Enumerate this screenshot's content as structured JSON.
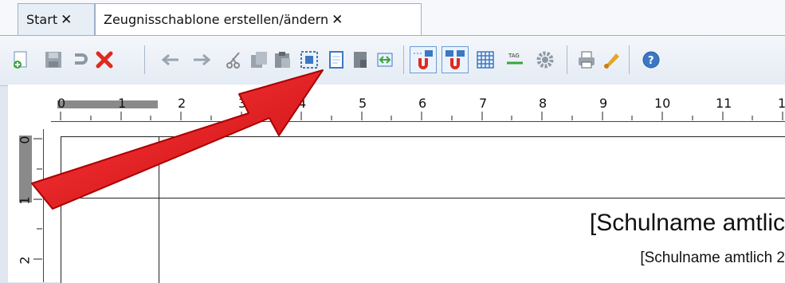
{
  "tabs": [
    {
      "label": "Start",
      "close": "✕",
      "active": false
    },
    {
      "label": "Zeugnisschablone erstellen/ändern",
      "close": "✕",
      "active": true
    }
  ],
  "ruler": {
    "horizontal": [
      "0",
      "1",
      "2",
      "3",
      "4",
      "5",
      "6",
      "7",
      "8",
      "9",
      "10",
      "11",
      "1"
    ],
    "vertical": [
      "0",
      "1",
      "2"
    ]
  },
  "document": {
    "school_name_official": "[Schulname amtlic",
    "school_name_official_2": "[Schulname amtlich 2"
  },
  "toolbar": {
    "icons": [
      "new-document-icon",
      "save-icon",
      "undo-icon",
      "delete-icon",
      "arrow-left-icon",
      "arrow-right-icon",
      "cut-icon",
      "copy-icon",
      "paste-icon",
      "select-frame-icon",
      "page-icon",
      "page-dark-icon",
      "page-link-icon",
      "magnet-snap-icon",
      "magnet-grid-icon",
      "grid-icon",
      "tag-icon",
      "settings-gear-icon",
      "print-icon",
      "bell-icon",
      "help-icon"
    ]
  },
  "colors": {
    "arrow": "#e8141a",
    "accent": "#3b78c4",
    "delete": "#e02a1d"
  }
}
